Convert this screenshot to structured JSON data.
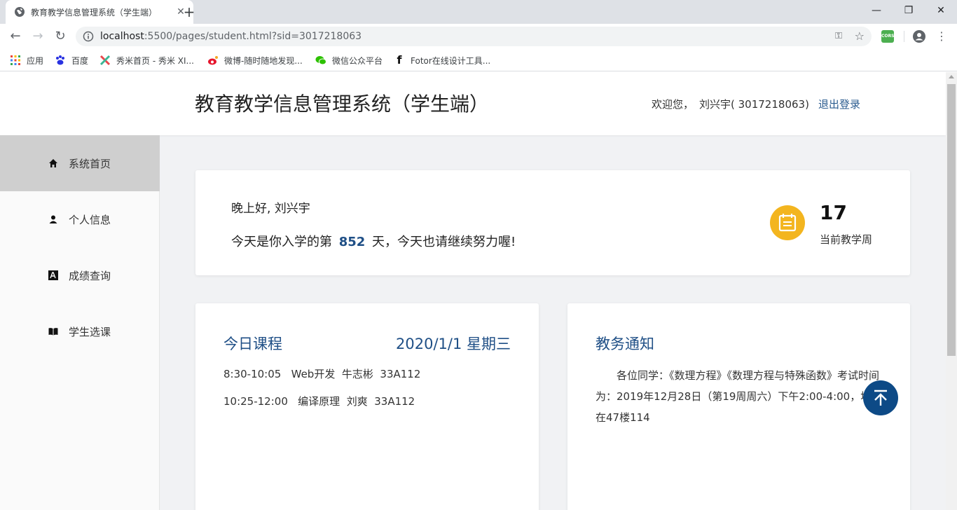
{
  "browser": {
    "tab_title": "教育教学信息管理系统（学生端）",
    "url_host": "localhost",
    "url_rest": ":5500/pages/student.html?sid=3017218063",
    "ext_cors_label": "CORS",
    "window_controls": {
      "minimize": "—",
      "restore": "❐",
      "close": "✕"
    },
    "bookmarks": [
      {
        "label": "应用",
        "icon": "apps-grid-icon"
      },
      {
        "label": "百度",
        "icon": "baidu-paw-icon"
      },
      {
        "label": "秀米首页 - 秀米 XI...",
        "icon": "xiumi-icon"
      },
      {
        "label": "微博-随时随地发现...",
        "icon": "weibo-icon"
      },
      {
        "label": "微信公众平台",
        "icon": "wechat-icon"
      },
      {
        "label": "Fotor在线设计工具...",
        "icon": "fotor-icon"
      }
    ]
  },
  "header": {
    "title": "教育教学信息管理系统（学生端）",
    "welcome": "欢迎您，",
    "user": "刘兴宇( 3017218063)",
    "logout": "退出登录"
  },
  "sidebar": {
    "items": [
      {
        "label": "系统首页",
        "icon": "home-icon",
        "active": true
      },
      {
        "label": "个人信息",
        "icon": "user-icon",
        "active": false
      },
      {
        "label": "成绩查询",
        "icon": "grades-icon",
        "active": false
      },
      {
        "label": "学生选课",
        "icon": "book-icon",
        "active": false
      }
    ]
  },
  "greeting": {
    "hello": "晚上好, 刘兴宇",
    "days_prefix": "今天是你入学的第",
    "days": "852",
    "days_suffix": "天，今天也请继续努力喔!",
    "week": "17",
    "week_label": "当前教学周"
  },
  "courses": {
    "title": "今日课程",
    "date": "2020/1/1  星期三",
    "rows": [
      "8:30-10:05   Web开发  牛志彬  33A112",
      "10:25-12:00   编译原理  刘爽  33A112"
    ]
  },
  "notice": {
    "title": "教务通知",
    "body": "各位同学：《数理方程》《数理方程与特殊函数》考试时间为：2019年12月28日（第19周周六）下午2:00-4:00，地点在47楼114"
  },
  "colors": {
    "accent": "#1f4f86",
    "calendar_badge": "#f3b51f",
    "back_to_top": "#0d4a86",
    "sidebar_active": "#cfcfcf"
  }
}
